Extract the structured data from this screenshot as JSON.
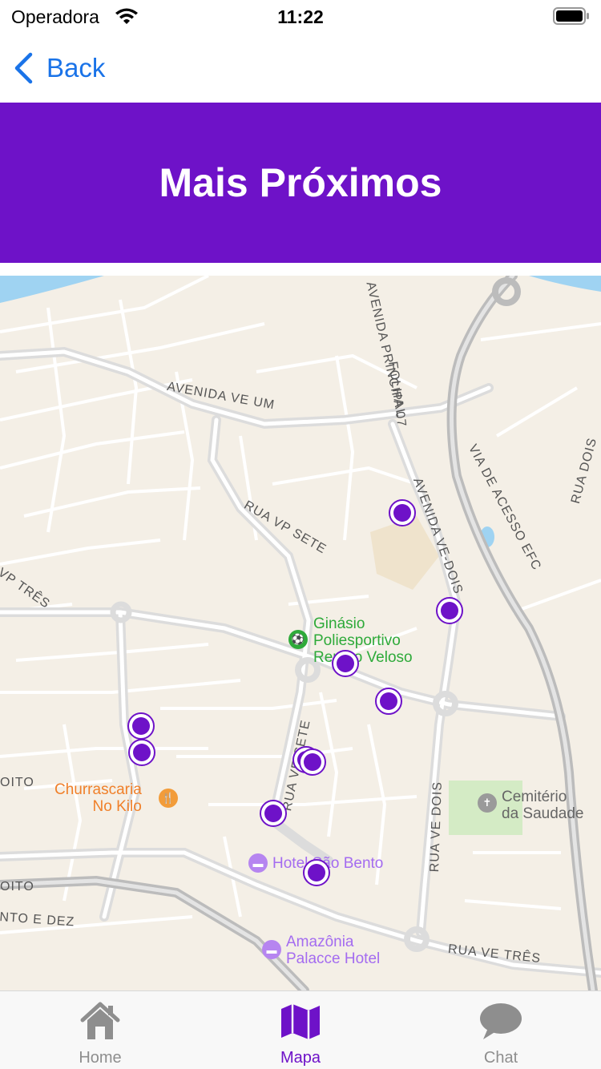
{
  "status_bar": {
    "carrier": "Operadora",
    "time": "11:22"
  },
  "nav": {
    "back_label": "Back"
  },
  "header": {
    "title": "Mais Próximos",
    "background": "#6e12c8"
  },
  "map": {
    "street_labels": {
      "avenida_ve_um": "AVENIDA VE UM",
      "avenida_principal": "AVENIDA PRINCIPAL",
      "folha_07": "FOLHA 07",
      "rua_vp_sete": "RUA VP SETE",
      "avenida_ve_dois": "AVENIDA VE-DOIS",
      "via_de_acesso": "VIA DE ACESSO EFC",
      "rua_dois": "RUA DOIS",
      "rua_vp_tres": "VP TRÊS",
      "rua_ve_sete": "RUA VE SETE",
      "rua_ve_dois": "RUA VE DOIS",
      "rua_ve_tres": "RUA VE TRÊS",
      "oito_1": "OITO",
      "oito_2": "OITO",
      "onto_e_dez": "NTO E DEZ"
    },
    "pois": {
      "ginasio": "Ginásio\nPoliesportivo\nRenato Veloso",
      "churrascaria": "Churrascaria\nNo Kilo",
      "cemiterio": "Cemitério\nda Saudade",
      "hotel_sao_bento": "Hotel São Bento",
      "amazonia_palace": "Amazônia\nPalacce Hotel"
    },
    "marker_count": 11,
    "marker_color": "#6e12c8"
  },
  "tabs": [
    {
      "label": "Home",
      "icon": "house-icon"
    },
    {
      "label": "Mapa",
      "icon": "map-icon",
      "active": true
    },
    {
      "label": "Chat",
      "icon": "chat-bubble-icon"
    }
  ]
}
